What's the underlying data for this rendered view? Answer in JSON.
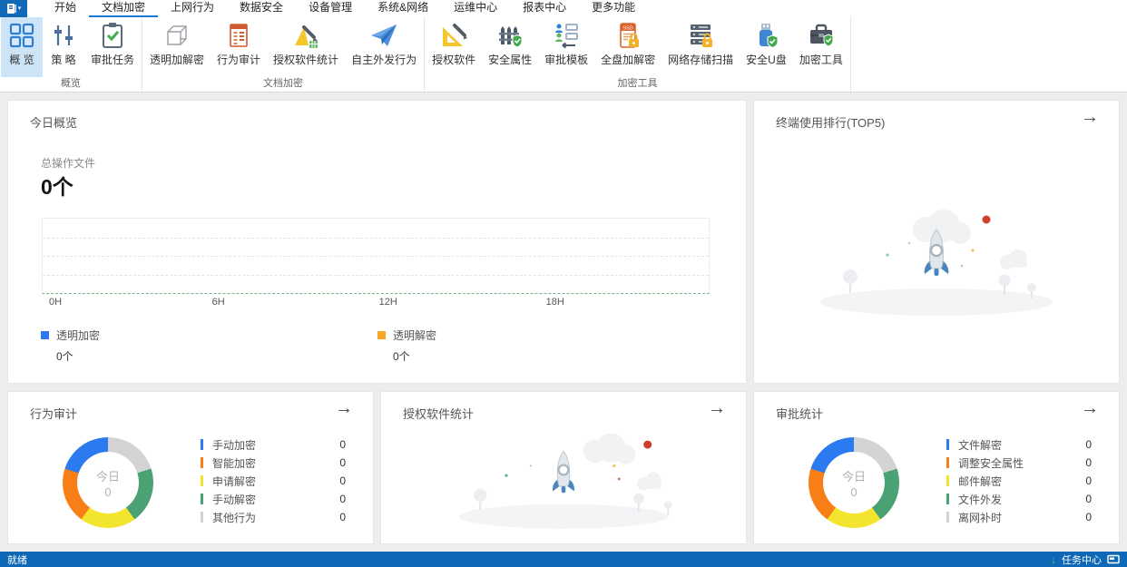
{
  "tabbar": {
    "tabs": [
      {
        "label": "开始"
      },
      {
        "label": "文档加密",
        "active": true
      },
      {
        "label": "上网行为"
      },
      {
        "label": "数据安全"
      },
      {
        "label": "设备管理"
      },
      {
        "label": "系统&网络"
      },
      {
        "label": "运维中心"
      },
      {
        "label": "报表中心"
      },
      {
        "label": "更多功能"
      }
    ]
  },
  "ribbon": {
    "groups": [
      {
        "label": "概览",
        "buttons": [
          {
            "label": "概 览",
            "icon": "grid-icon",
            "selected": true
          },
          {
            "label": "策 略",
            "icon": "sliders-icon"
          },
          {
            "label": "审批任务",
            "icon": "clipboard-check-icon"
          }
        ]
      },
      {
        "label": "文档加密",
        "buttons": [
          {
            "label": "透明加解密",
            "icon": "cube-icon"
          },
          {
            "label": "行为审计",
            "icon": "audit-list-icon"
          },
          {
            "label": "授权软件统计",
            "icon": "stats-pencil-icon"
          },
          {
            "label": "自主外发行为",
            "icon": "paper-plane-icon"
          }
        ]
      },
      {
        "label": "加密工具",
        "buttons": [
          {
            "label": "授权软件",
            "icon": "setsquare-pencil-icon"
          },
          {
            "label": "安全属性",
            "icon": "fence-shield-icon"
          },
          {
            "label": "审批模板",
            "icon": "approval-template-icon"
          },
          {
            "label": "全盘加解密",
            "icon": "ssd-lock-icon"
          },
          {
            "label": "网络存储扫描",
            "icon": "server-lock-icon"
          },
          {
            "label": "安全U盘",
            "icon": "usb-shield-icon"
          },
          {
            "label": "加密工具",
            "icon": "toolbox-shield-icon"
          }
        ]
      }
    ]
  },
  "panels": {
    "today": {
      "title": "今日概览",
      "stat_label": "总操作文件",
      "stat_value": "0个",
      "chart": {
        "type": "line",
        "x_ticks": [
          "0H",
          "6H",
          "12H",
          "18H"
        ],
        "baseline_color": "#69bd85",
        "series": [
          {
            "name": "透明加密",
            "total": "0个",
            "color": "#2b7af0",
            "values": [
              0,
              0,
              0,
              0
            ]
          },
          {
            "name": "透明解密",
            "total": "0个",
            "color": "#f5a623",
            "values": [
              0,
              0,
              0,
              0
            ]
          }
        ]
      }
    },
    "terminal_rank": {
      "title": "终端使用排行(TOP5)",
      "arrow": "→"
    },
    "behavior_audit": {
      "title": "行为审计",
      "arrow": "→",
      "center_label": "今日",
      "center_value": "0",
      "items": [
        {
          "label": "手动加密",
          "value": "0",
          "color": "#2b7af0"
        },
        {
          "label": "智能加密",
          "value": "0",
          "color": "#f87f17"
        },
        {
          "label": "申请解密",
          "value": "0",
          "color": "#f3e42e"
        },
        {
          "label": "手动解密",
          "value": "0",
          "color": "#4aa173"
        },
        {
          "label": "其他行为",
          "value": "0",
          "color": "#d3d3d3"
        }
      ]
    },
    "software_stats": {
      "title": "授权软件统计",
      "arrow": "→"
    },
    "approval_stats": {
      "title": "审批统计",
      "arrow": "→",
      "center_label": "今日",
      "center_value": "0",
      "items": [
        {
          "label": "文件解密",
          "value": "0",
          "color": "#2b7af0"
        },
        {
          "label": "调整安全属性",
          "value": "0",
          "color": "#f87f17"
        },
        {
          "label": "邮件解密",
          "value": "0",
          "color": "#f3e42e"
        },
        {
          "label": "文件外发",
          "value": "0",
          "color": "#4aa173"
        },
        {
          "label": "离网补时",
          "value": "0",
          "color": "#d3d3d3"
        }
      ]
    }
  },
  "statusbar": {
    "ready": "就绪",
    "task_center": "任务中心"
  },
  "colors": {
    "app_button_bg": "#1269b8",
    "tab_underline": "#1f7ad4",
    "selected_ribbon_bg": "#cde4f7",
    "statusbar_bg": "#0f68b7",
    "status_green": "#4cd15e",
    "content_bg": "#ecedee"
  }
}
